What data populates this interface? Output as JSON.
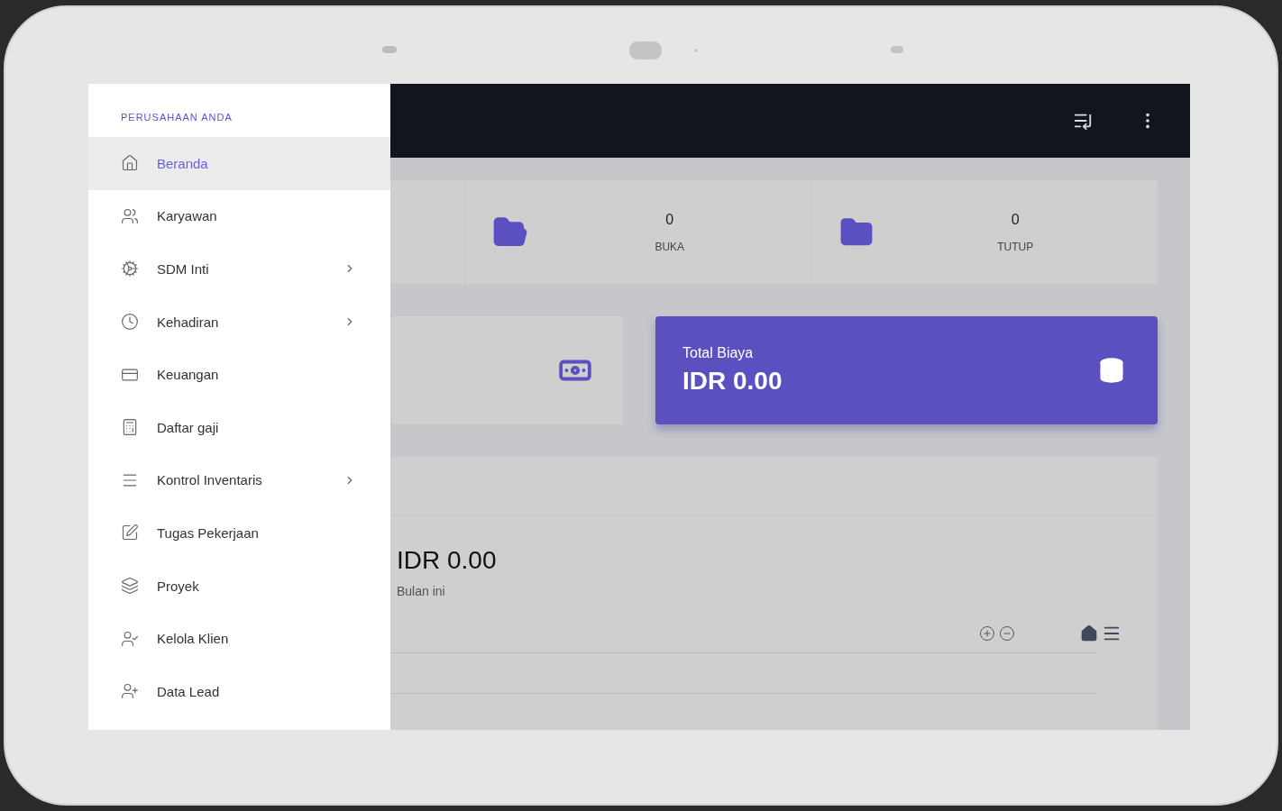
{
  "sidebar": {
    "heading": "PERUSAHAAN ANDA",
    "items": [
      {
        "label": "Beranda",
        "selected": true,
        "has_submenu": false
      },
      {
        "label": "Karyawan",
        "selected": false,
        "has_submenu": false
      },
      {
        "label": "SDM Inti",
        "selected": false,
        "has_submenu": true
      },
      {
        "label": "Kehadiran",
        "selected": false,
        "has_submenu": true
      },
      {
        "label": "Keuangan",
        "selected": false,
        "has_submenu": false
      },
      {
        "label": "Daftar gaji",
        "selected": false,
        "has_submenu": false
      },
      {
        "label": "Kontrol Inventaris",
        "selected": false,
        "has_submenu": true
      },
      {
        "label": "Tugas Pekerjaan",
        "selected": false,
        "has_submenu": false
      },
      {
        "label": "Proyek",
        "selected": false,
        "has_submenu": false
      },
      {
        "label": "Kelola Klien",
        "selected": false,
        "has_submenu": false
      },
      {
        "label": "Data Lead",
        "selected": false,
        "has_submenu": false
      }
    ]
  },
  "stats": [
    {
      "value": "0",
      "label": "BUKA"
    },
    {
      "value": "0",
      "label": "TUTUP"
    }
  ],
  "total_card": {
    "title": "Total Biaya",
    "amount": "IDR 0.00"
  },
  "chart_card": {
    "amount": "IDR 0.00",
    "caption": "Bulan ini"
  }
}
